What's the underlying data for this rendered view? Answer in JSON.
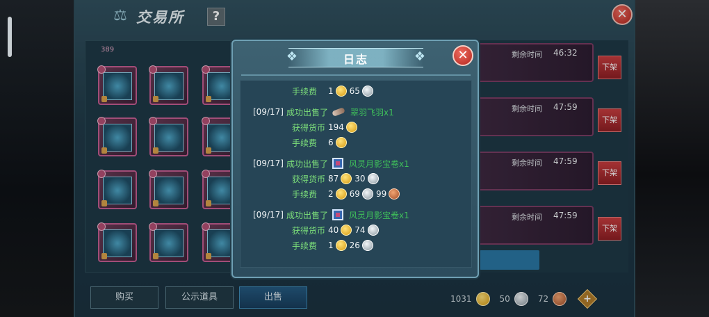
{
  "window": {
    "title": "交易所",
    "help_label": "?",
    "close_label": "✕"
  },
  "grid": {
    "count_label": "389"
  },
  "listings": [
    {
      "time_label": "剩余时间",
      "time_value": "46:32",
      "button": "下架"
    },
    {
      "time_label": "剩余时间",
      "time_value": "47:59",
      "button": "下架"
    },
    {
      "time_label": "剩余时间",
      "time_value": "47:59",
      "button": "下架"
    },
    {
      "time_label": "剩余时间",
      "time_value": "47:59",
      "button": "下架"
    }
  ],
  "tabs": [
    "购买",
    "公示道具",
    "出售"
  ],
  "active_tab": "出售",
  "currency": {
    "gold": "1031",
    "silver": "50",
    "copper": "72",
    "add_label": "+"
  },
  "dialog": {
    "title": "日志",
    "close_label": "✕",
    "entries": [
      {
        "fee_label": "手续费",
        "fee": [
          "1",
          "65"
        ]
      },
      {
        "date": "[09/17]",
        "action": "成功出售了",
        "item_name": "翠羽飞羽x1",
        "earn_label": "获得货币",
        "earn": [
          "194"
        ],
        "fee_label": "手续费",
        "fee": [
          "6"
        ]
      },
      {
        "date": "[09/17]",
        "action": "成功出售了",
        "item_name": "风灵月影宝卷x1",
        "earn_label": "获得货币",
        "earn": [
          "87",
          "30"
        ],
        "fee_label": "手续费",
        "fee": [
          "2",
          "69",
          "99"
        ]
      },
      {
        "date": "[09/17]",
        "action": "成功出售了",
        "item_name": "风灵月影宝卷x1",
        "earn_label": "获得货币",
        "earn": [
          "40",
          "74"
        ],
        "fee_label": "手续费",
        "fee": [
          "1",
          "26"
        ]
      }
    ]
  },
  "colors": {
    "accent_green": "#7de07a",
    "close_red": "#c8322a",
    "item_green": "#3fbf5a"
  }
}
